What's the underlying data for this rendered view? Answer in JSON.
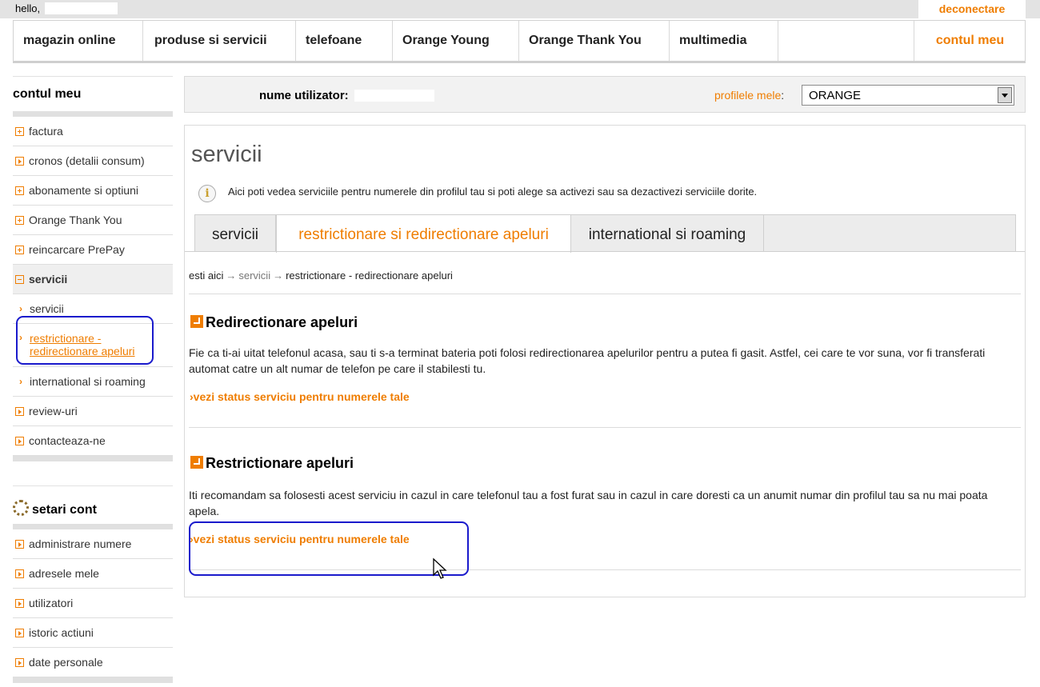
{
  "topbar": {
    "greeting": "hello,",
    "logout": "deconectare"
  },
  "nav": {
    "items": [
      "magazin online",
      "produse si servicii",
      "telefoane",
      "Orange Young",
      "Orange Thank You",
      "multimedia"
    ],
    "account": "contul meu"
  },
  "sidebar": {
    "title": "contul meu",
    "items": [
      "factura",
      "cronos (detalii consum)",
      "abonamente si optiuni",
      "Orange Thank You",
      "reincarcare PrePay"
    ],
    "active_group": "servicii",
    "sub_items": [
      "servicii",
      "restrictionare - redirectionare apeluri",
      "international si roaming"
    ],
    "after_items": [
      "review-uri",
      "contacteaza-ne"
    ],
    "settings_title": "setari cont",
    "settings_items": [
      "administrare numere",
      "adresele mele",
      "utilizatori",
      "istoric actiuni",
      "date personale"
    ]
  },
  "profilebar": {
    "username_label": "nume utilizator:",
    "profiles_label": "profilele mele",
    "profiles_colon": ":",
    "profile_value": "ORANGE"
  },
  "content": {
    "title": "servicii",
    "info": "Aici poti vedea serviciile pentru numerele din profilul tau si poti alege sa activezi sau sa dezactivezi serviciile dorite.",
    "tabs": [
      "servicii",
      "restrictionare si redirectionare apeluri",
      "international si roaming"
    ],
    "active_tab": 1,
    "breadcrumb": {
      "start": "esti aici",
      "mid": "servicii",
      "current": "restrictionare - redirectionare apeluri",
      "sep": "→"
    },
    "sections": [
      {
        "title": "Redirectionare apeluri",
        "text": "Fie ca ti-ai uitat telefonul acasa, sau ti s-a terminat bateria poti folosi redirectionarea apelurilor pentru a putea fi gasit. Astfel, cei care te vor suna, vor fi transferati automat catre un alt numar de telefon pe care il stabilesti tu.",
        "link": "vezi status serviciu pentru numerele tale"
      },
      {
        "title": "Restrictionare apeluri",
        "text": "Iti recomandam sa folosesti acest serviciu in cazul in care telefonul tau a fost furat sau in cazul in care doresti ca un anumit numar din profilul tau sa nu mai poata apela.",
        "link": "vezi status serviciu pentru numerele tale"
      }
    ],
    "link_prefix": "›"
  },
  "colors": {
    "accent": "#ef7d00",
    "highlight": "#1a1acc"
  }
}
